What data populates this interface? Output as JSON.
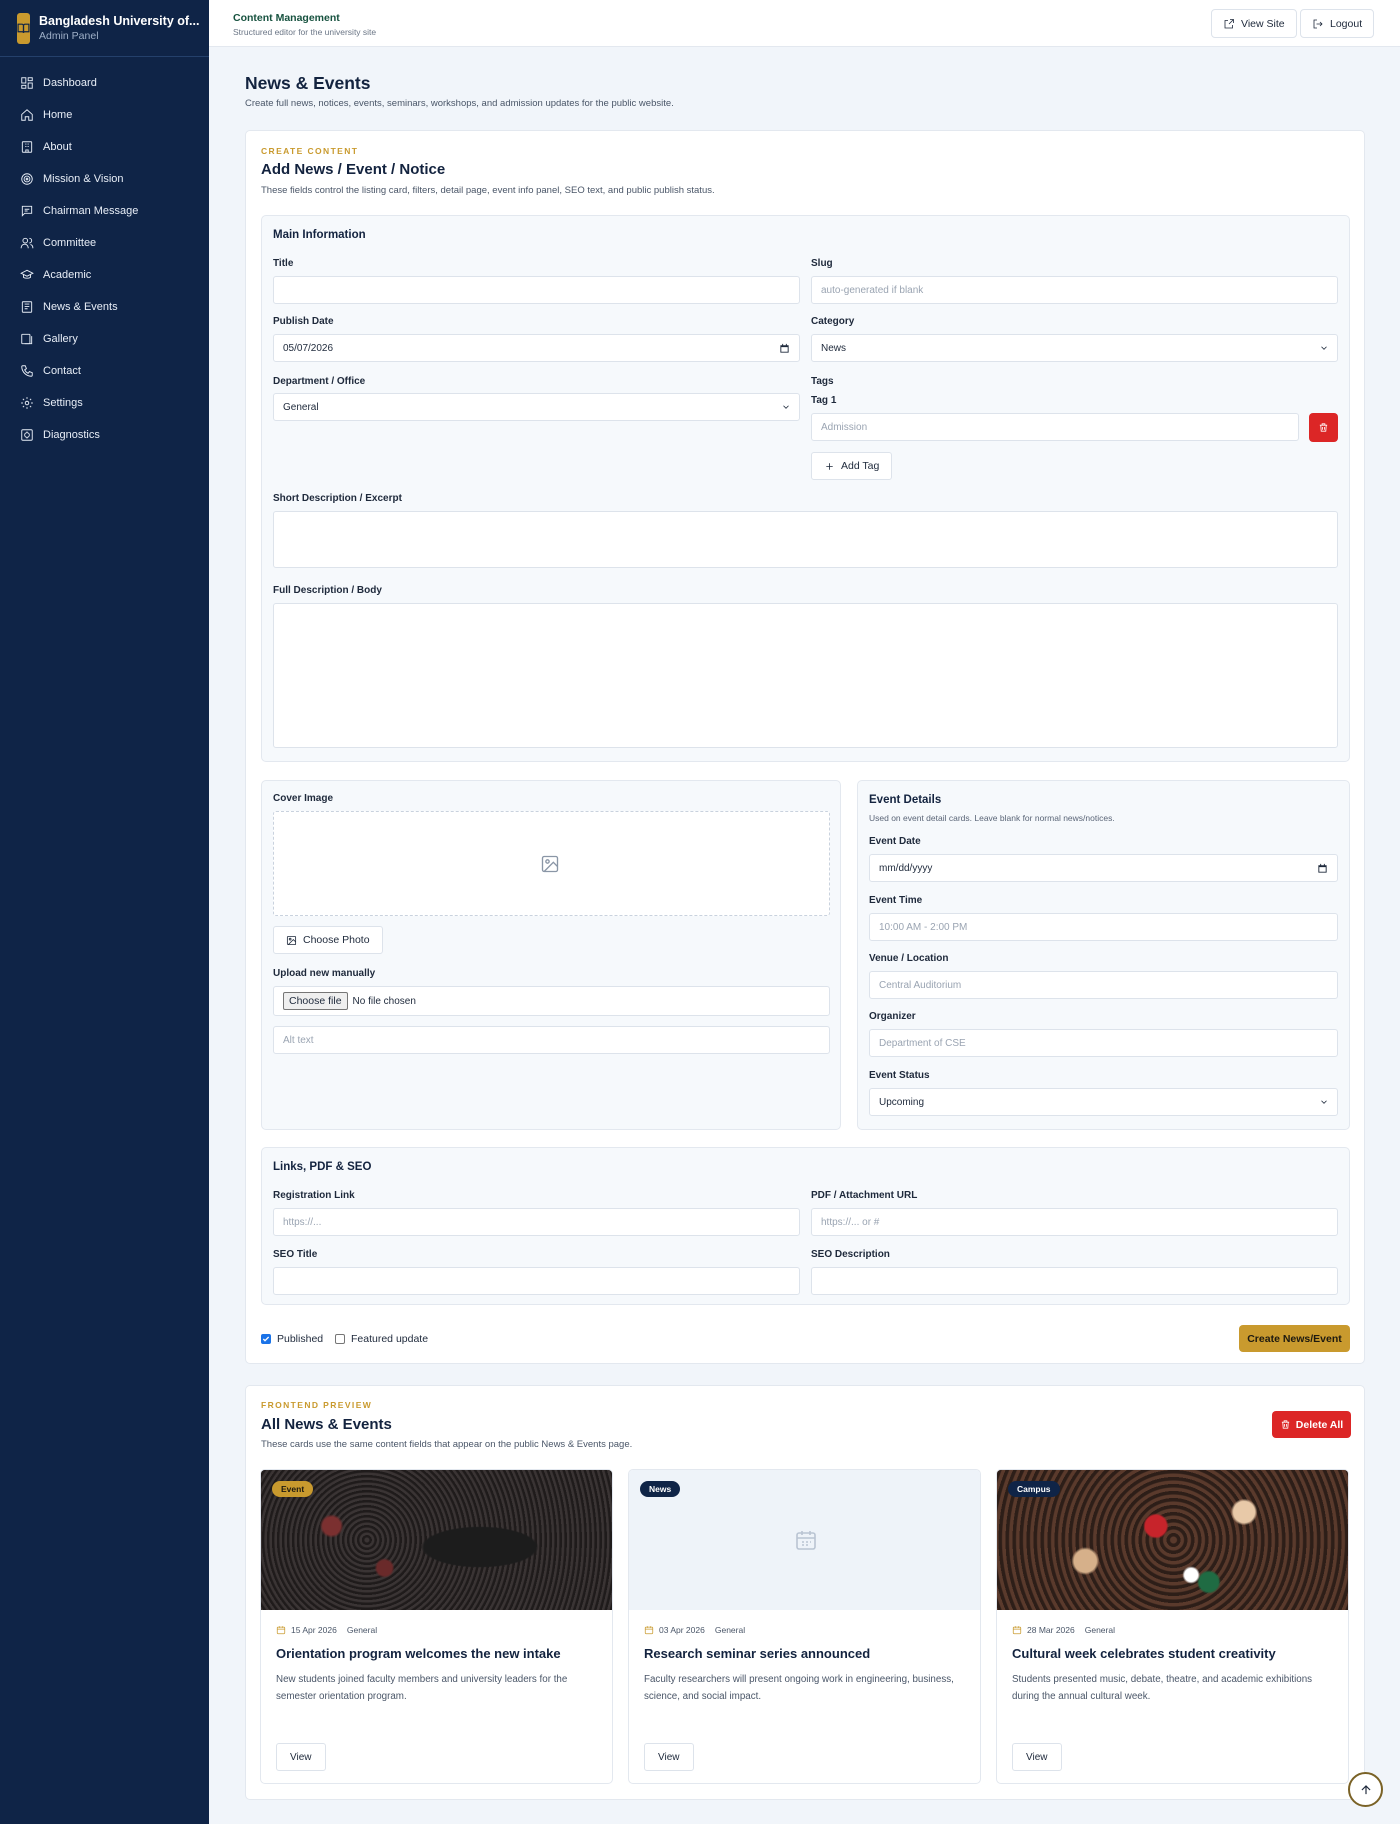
{
  "sidebar": {
    "brand_title": "Bangladesh University of...",
    "brand_sub": "Admin Panel",
    "items": [
      {
        "label": "Dashboard",
        "icon": "grid-icon"
      },
      {
        "label": "Home",
        "icon": "home-icon"
      },
      {
        "label": "About",
        "icon": "building-icon"
      },
      {
        "label": "Mission & Vision",
        "icon": "target-icon"
      },
      {
        "label": "Chairman Message",
        "icon": "message-icon"
      },
      {
        "label": "Committee",
        "icon": "users-icon"
      },
      {
        "label": "Academic",
        "icon": "graduation-cap-icon"
      },
      {
        "label": "News & Events",
        "icon": "newspaper-icon"
      },
      {
        "label": "Gallery",
        "icon": "gallery-icon"
      },
      {
        "label": "Contact",
        "icon": "phone-icon"
      },
      {
        "label": "Settings",
        "icon": "gear-icon"
      },
      {
        "label": "Diagnostics",
        "icon": "diagnostics-icon"
      }
    ]
  },
  "topbar": {
    "title": "Content Management",
    "subtitle": "Structured editor for the university site",
    "view_site": "View Site",
    "logout": "Logout"
  },
  "page": {
    "title": "News & Events",
    "subtitle": "Create full news, notices, events, seminars, workshops, and admission updates for the public website."
  },
  "create": {
    "eyebrow": "CREATE CONTENT",
    "title": "Add News / Event / Notice",
    "desc": "These fields control the listing card, filters, detail page, event info panel, SEO text, and public publish status.",
    "main": {
      "heading": "Main Information",
      "title_label": "Title",
      "title_value": "",
      "slug_label": "Slug",
      "slug_placeholder": "auto-generated if blank",
      "publish_label": "Publish Date",
      "publish_value": "05/07/2026",
      "category_label": "Category",
      "category_value": "News",
      "dept_label": "Department / Office",
      "dept_value": "General",
      "tags_label": "Tags",
      "tag1_label": "Tag 1",
      "tag1_placeholder": "Admission",
      "add_tag": "Add Tag",
      "short_label": "Short Description / Excerpt",
      "full_label": "Full Description / Body"
    },
    "cover": {
      "label": "Cover Image",
      "choose_photo": "Choose Photo",
      "upload_label": "Upload new manually",
      "choose_file": "Choose file",
      "no_file": "No file chosen",
      "alt_placeholder": "Alt text"
    },
    "event": {
      "heading": "Event Details",
      "desc": "Used on event detail cards. Leave blank for normal news/notices.",
      "date_label": "Event Date",
      "date_value": "mm/dd/yyyy",
      "time_label": "Event Time",
      "time_placeholder": "10:00 AM - 2:00 PM",
      "venue_label": "Venue / Location",
      "venue_placeholder": "Central Auditorium",
      "organizer_label": "Organizer",
      "organizer_placeholder": "Department of CSE",
      "status_label": "Event Status",
      "status_value": "Upcoming"
    },
    "links": {
      "heading": "Links, PDF & SEO",
      "reg_label": "Registration Link",
      "reg_placeholder": "https://...",
      "pdf_label": "PDF / Attachment URL",
      "pdf_placeholder": "https://... or #",
      "seo_title_label": "SEO Title",
      "seo_desc_label": "SEO Description"
    },
    "published_label": "Published",
    "featured_label": "Featured update",
    "submit": "Create News/Event"
  },
  "preview": {
    "eyebrow": "FRONTEND PREVIEW",
    "title": "All News & Events",
    "desc": "These cards use the same content fields that appear on the public News & Events page.",
    "delete_all": "Delete All",
    "cards": [
      {
        "badge": "Event",
        "date": "15 Apr 2026",
        "dept": "General",
        "title": "Orientation program welcomes the new intake",
        "desc": "New students joined faculty members and university leaders for the semester orientation program.",
        "view": "View"
      },
      {
        "badge": "News",
        "date": "03 Apr 2026",
        "dept": "General",
        "title": "Research seminar series announced",
        "desc": "Faculty researchers will present ongoing work in engineering, business, science, and social impact.",
        "view": "View"
      },
      {
        "badge": "Campus",
        "date": "28 Mar 2026",
        "dept": "General",
        "title": "Cultural week celebrates student creativity",
        "desc": "Students presented music, debate, theatre, and academic exhibitions during the annual cultural week.",
        "view": "View"
      }
    ]
  },
  "colors": {
    "sidebar": "#0f2447",
    "accent_gold": "#c99a2e",
    "danger": "#dc2626"
  }
}
